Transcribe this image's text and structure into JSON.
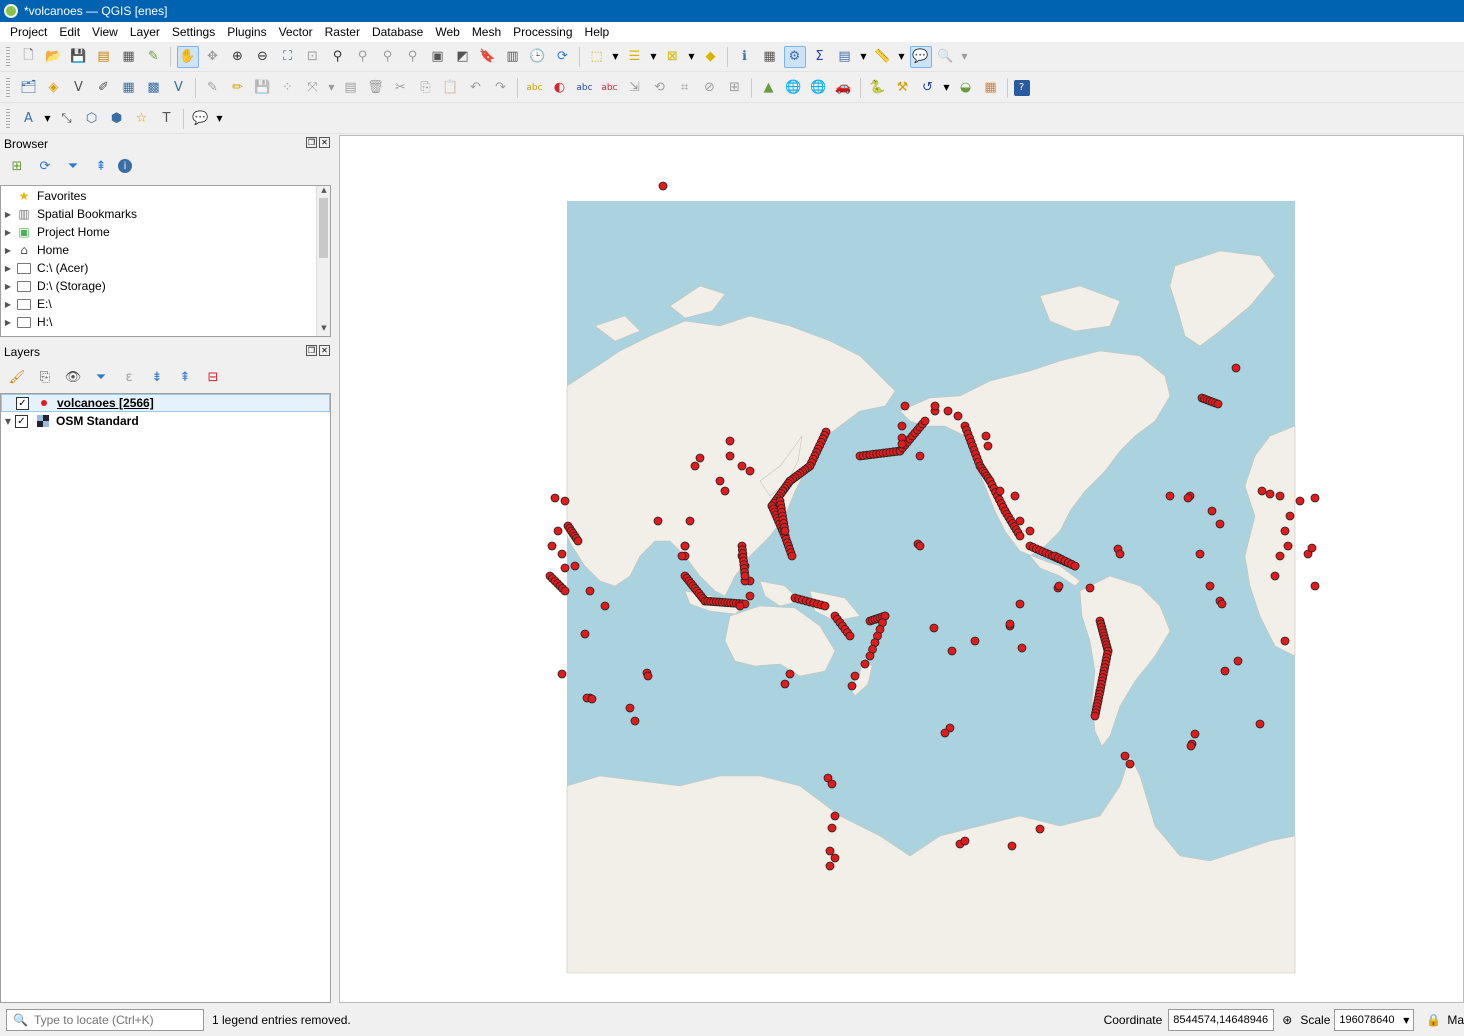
{
  "window": {
    "title": "*volcanoes — QGIS [enes]"
  },
  "menu": [
    "Project",
    "Edit",
    "View",
    "Layer",
    "Settings",
    "Plugins",
    "Vector",
    "Raster",
    "Database",
    "Web",
    "Mesh",
    "Processing",
    "Help"
  ],
  "browser": {
    "title": "Browser",
    "items": [
      {
        "label": "Favorites",
        "icon": "star-icon"
      },
      {
        "label": "Spatial Bookmarks",
        "icon": "bookmark-icon"
      },
      {
        "label": "Project Home",
        "icon": "project-home-icon"
      },
      {
        "label": "Home",
        "icon": "home-icon"
      },
      {
        "label": "C:\\ (Acer)",
        "icon": "folder-icon"
      },
      {
        "label": "D:\\ (Storage)",
        "icon": "folder-icon"
      },
      {
        "label": "E:\\",
        "icon": "folder-icon"
      },
      {
        "label": "H:\\",
        "icon": "folder-icon"
      }
    ]
  },
  "layers": {
    "title": "Layers",
    "items": [
      {
        "label": "volcanoes [2566]",
        "checked": true,
        "icon": "point-symbol-icon"
      },
      {
        "label": "OSM Standard",
        "checked": true,
        "icon": "raster-tile-icon"
      }
    ]
  },
  "status": {
    "locator_placeholder": "Type to locate (Ctrl+K)",
    "message": "1 legend entries removed.",
    "coordinate_label": "Coordinate",
    "coordinate_value": "8544574,14648946",
    "scale_label": "Scale",
    "scale_value": "196078640",
    "magnifier_label": "Ma"
  },
  "colors": {
    "titlebar": "#0063b1",
    "ocean": "#aad3df",
    "land": "#f2efe9",
    "point": "#e31a1c"
  }
}
